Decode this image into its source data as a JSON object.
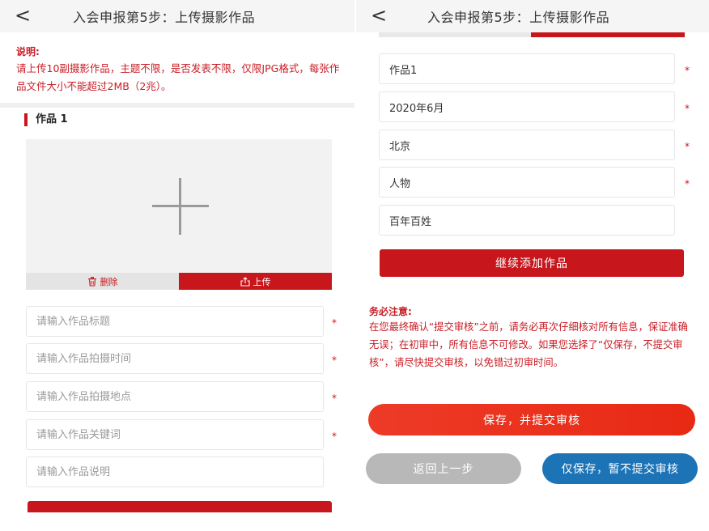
{
  "header": {
    "back_glyph": "<",
    "title": "入会申报第5步：上传摄影作品"
  },
  "notice": {
    "label": "说明:",
    "text": "请上传10副摄影作品，主题不限，是否发表不限，仅限JPG格式，每张作品文件大小不能超过2MB（2兆）。"
  },
  "work": {
    "section_title": "作品 1",
    "delete_label": "删除",
    "upload_label": "上传",
    "required_mark": "*",
    "placeholders": {
      "title": "请输入作品标题",
      "time": "请输入作品拍摄时间",
      "location": "请输入作品拍摄地点",
      "keywords": "请输入作品关键词",
      "description": "请输入作品说明"
    },
    "values": {
      "title": "作品1",
      "time": "2020年6月",
      "location": "北京",
      "keywords": "人物",
      "description": "百年百姓"
    }
  },
  "actions": {
    "continue_label": "继续添加作品",
    "save_submit_label": "保存，并提交审核",
    "back_label": "返回上一步",
    "save_only_label": "仅保存，暂不提交审核"
  },
  "warning": {
    "label": "务必注意:",
    "text": "在您最终确认“提交审核”之前，请务必再次仔细核对所有信息，保证准确无误；在初审中，所有信息不可修改。如果您选择了“仅保存，不提交审核”，请尽快提交审核，以免错过初审时间。"
  },
  "colors": {
    "brand_red": "#c8161d",
    "notice_red": "#c81d25",
    "save_only_blue": "#1c73b6",
    "back_gray": "#b8b8b8"
  },
  "icons": {
    "delete": "trash-icon",
    "upload": "upload-icon",
    "add_photo": "plus-icon",
    "back": "chevron-left-icon"
  }
}
